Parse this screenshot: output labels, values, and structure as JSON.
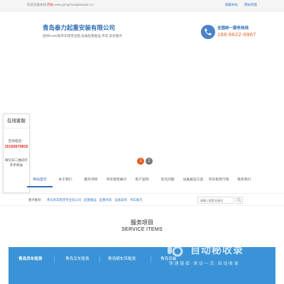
{
  "topbar": {
    "welcome": "欢迎光临本站",
    "separator": "网站",
    "url": "www.gongchangbanqian.cn",
    "bookmark_label": "收藏本站",
    "sitemap_label": "网站地图"
  },
  "header": {
    "company": "青岛泰力起重安装有限公司",
    "slogan": "提供8-500吨吊车租赁出租,设备起重搬运,吊装,安装服务",
    "hotline_label": "全国统一服务热线",
    "hotline_number": "188-6622-8967"
  },
  "banner": {
    "dots": [
      "1",
      "2"
    ]
  },
  "service": {
    "title": "在线客服",
    "phone_label": "咨询电话：",
    "phone": "15192670815",
    "wechat_label": "微信扫二维码打开手机站"
  },
  "nav": {
    "items": [
      "网站首页",
      "关于我们",
      "服务项目",
      "吊车租赁展示",
      "客户案例",
      "常见问题",
      "设备搬运方案",
      "吊车租赁行情",
      "联系我们"
    ],
    "active_index": 0
  },
  "search": {
    "hot_label": "重点推荐：",
    "keywords": [
      "青岛吊车租赁专业化公司",
      "起重搬运",
      "起重吊装",
      "设备安装",
      "吊车展示"
    ],
    "placeholder": "请输入搜索关键词"
  },
  "section": {
    "title": "服务项目",
    "subtitle": "SERVICE ITEMS"
  },
  "tabs": {
    "items": [
      "青岛吊车租赁",
      "青岛叉车租赁",
      "青岛随车吊租赁",
      "青岛吊装"
    ],
    "active_index": 0
  },
  "watermark": {
    "text": "自动秘收录",
    "sub": "快 速 链 接 · 来 访 一 次 · 自 动 收 录"
  },
  "colors": {
    "brand_blue": "#2f6db5",
    "hotline_orange": "#e55c20",
    "phone_red": "#e2231a",
    "tab_blue": "#3a93d6"
  }
}
